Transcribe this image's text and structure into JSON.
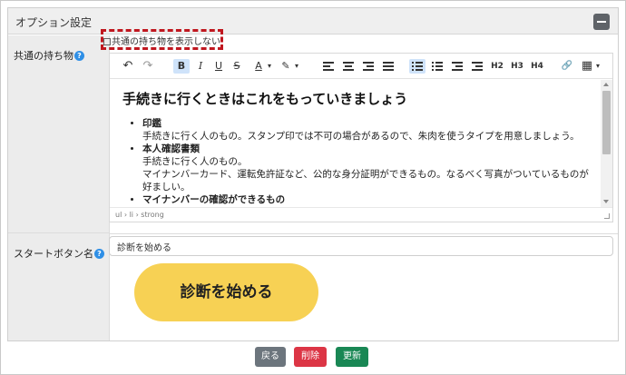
{
  "panel": {
    "title": "オプション設定"
  },
  "common_items": {
    "label": "共通の持ち物",
    "help": "?",
    "checkbox_label": "共通の持ち物を表示しない",
    "toolbar": {
      "undo": "↶",
      "redo": "↷",
      "bold": "B",
      "italic": "I",
      "underline": "U",
      "strike": "S",
      "text_color": "A",
      "highlight": "✎",
      "h2": "H2",
      "h3": "H3",
      "h4": "H4",
      "link": "🔗",
      "table": "▦"
    },
    "editor": {
      "heading": "手続きに行くときはこれをもっていきましょう",
      "items": [
        {
          "title": "印鑑",
          "lines": [
            "手続きに行く人のもの。スタンプ印では不可の場合があるので、朱肉を使うタイプを用意しましょう。"
          ]
        },
        {
          "title": "本人確認書類",
          "lines": [
            "手続きに行く人のもの。",
            "マイナンバーカード、運転免許証など、公的な身分証明ができるもの。なるべく写真がついているものが好ましい。"
          ]
        },
        {
          "title": "マイナンバーの確認ができるもの",
          "lines": []
        }
      ],
      "status_path": "ul › li › strong"
    }
  },
  "start_button": {
    "label": "スタートボタン名",
    "help": "?",
    "value": "診断を始める",
    "preview_text": "診断を始める"
  },
  "footer": {
    "back": "戻る",
    "delete": "削除",
    "update": "更新"
  },
  "colors": {
    "highlight_border": "#c0171f",
    "preview_button": "#f7d154",
    "back_button": "#6c757d",
    "delete_button": "#dc3545",
    "update_button": "#198754",
    "help_icon": "#2f8fe6"
  }
}
